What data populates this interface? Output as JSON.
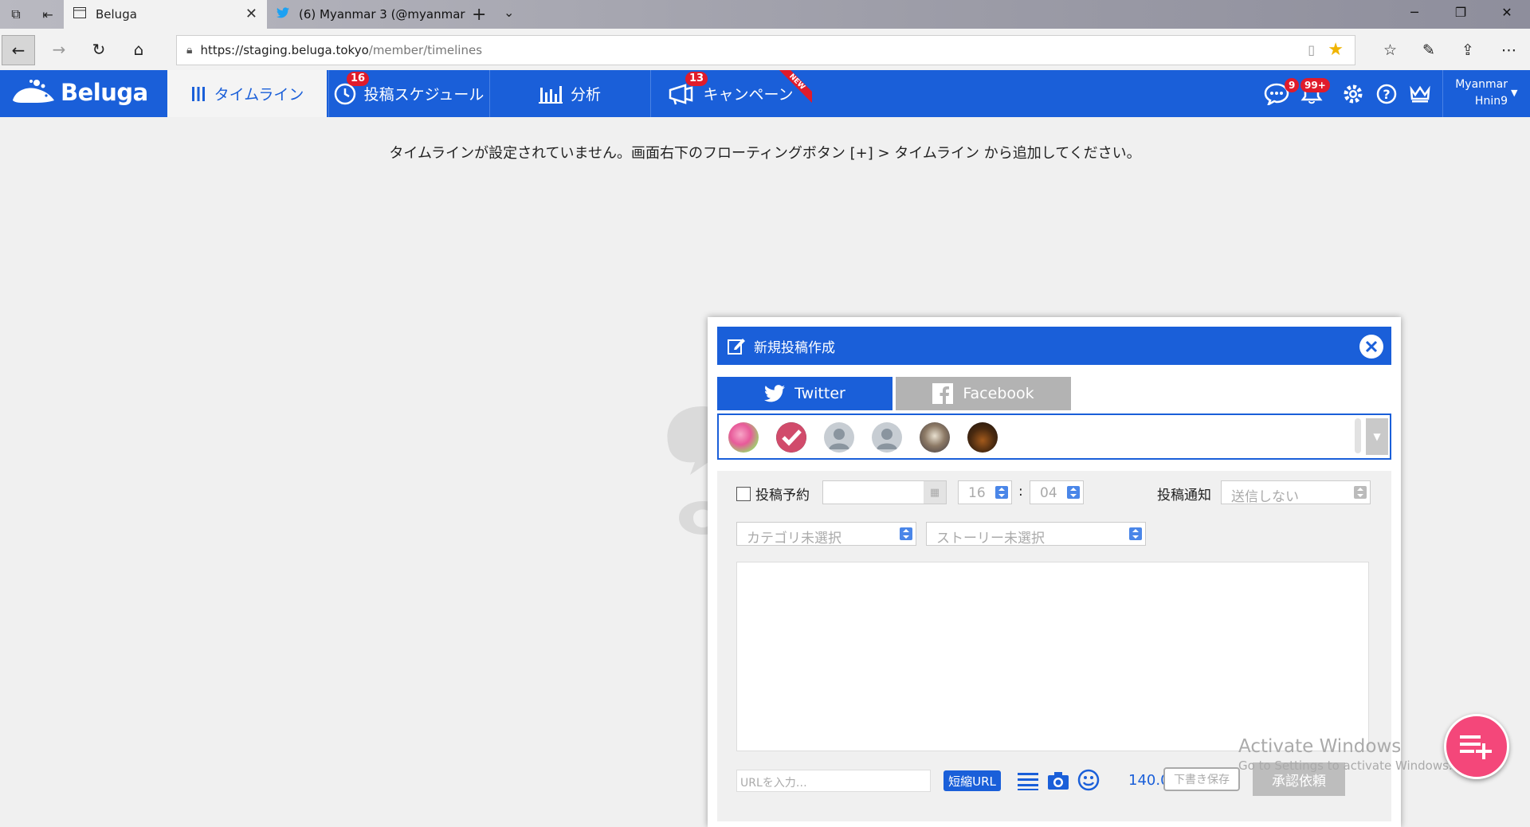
{
  "browser": {
    "tabs": [
      {
        "title": "Beluga",
        "active": true
      },
      {
        "title": "(6) Myanmar 3 (@myanmar",
        "active": false
      }
    ],
    "url_host": "https://staging.beluga.tokyo",
    "url_path": "/member/timelines"
  },
  "app": {
    "logo_text": "Beluga",
    "nav": {
      "timeline": "タイムライン",
      "schedule": "投稿スケジュール",
      "schedule_badge": "16",
      "analytics": "分析",
      "campaign": "キャンペーン",
      "campaign_badge": "13",
      "campaign_flag": "NEW"
    },
    "messages_badge": "9",
    "notifications_badge": "99+",
    "user_line1": "Myanmar",
    "user_line2": "Hnin9",
    "brand_color": "#1a5fd9"
  },
  "content": {
    "empty_notice": "タイムラインが設定されていません。画面右下のフローティングボタン [+] > タイムライン から追加してください。"
  },
  "modal": {
    "title": "新規投稿作成",
    "tab_twitter": "Twitter",
    "tab_facebook": "Facebook",
    "schedule_label": "投稿予約",
    "hour": "16",
    "minute": "04",
    "time_sep": ":",
    "notify_label": "投稿通知",
    "notify_value": "送信しない",
    "category_placeholder": "カテゴリ未選択",
    "story_placeholder": "ストーリー未選択",
    "url_placeholder": "URLを入力…",
    "shorten_button": "短縮URL",
    "char_count": "140.0",
    "draft_button": "下書き保存",
    "approve_button": "承認依頼"
  },
  "os": {
    "activate_title": "Activate Windows",
    "activate_sub": "Go to Settings to activate Windows."
  }
}
